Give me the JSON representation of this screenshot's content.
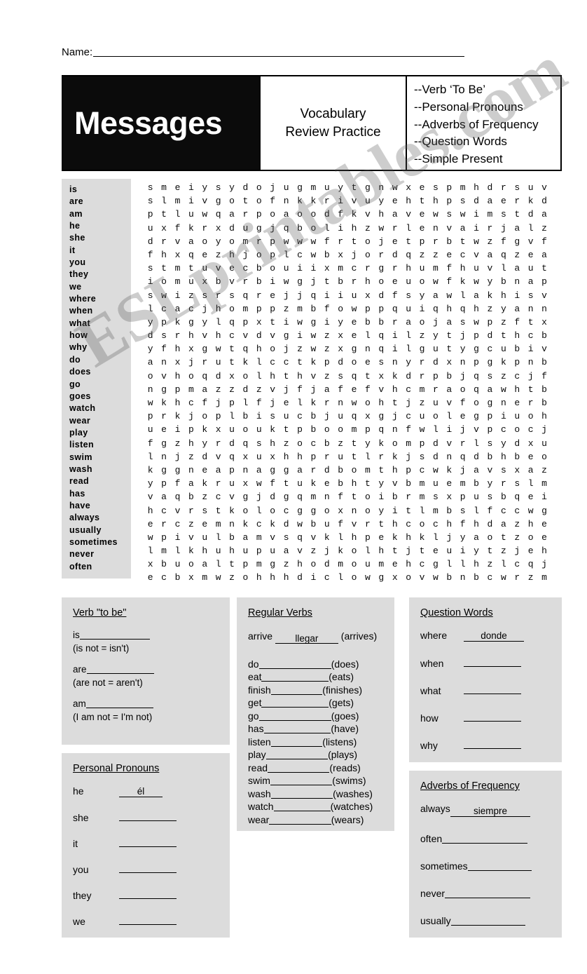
{
  "name_field": {
    "label": "Name:",
    "value": ""
  },
  "header": {
    "title": "Messages",
    "subtitle_line1": "Vocabulary",
    "subtitle_line2": "Review Practice",
    "topics": [
      "--Verb ‘To Be’",
      "--Personal Pronouns",
      "--Adverbs of Frequency",
      "--Question Words",
      "--Simple Present"
    ]
  },
  "word_bank": [
    "is",
    "are",
    "am",
    "he",
    "she",
    "it",
    "you",
    "they",
    "we",
    "where",
    "when",
    "what",
    "how",
    "why",
    "do",
    "does",
    "go",
    "goes",
    "watch",
    "wear",
    "play",
    "listen",
    "swim",
    "wash",
    "read",
    "has",
    "have",
    "always",
    "usually",
    "sometimes",
    "never",
    "often"
  ],
  "word_search": {
    "columns": 31,
    "rows": 30,
    "rows_text": [
      "smeiysydojugmuytgnwxespmhdrsuv",
      "slmivgotofnkkrivuyehthpsdaerkd",
      "ptluwqarpoaoodfkvhavewswimstda",
      "uxfkrxdugjqbolihzwrlenvairjalz",
      "drvaoyomrpwwwfrtojetprbtwzfgvf",
      "fhxqezhjoplcwbxjordqzzecvaqzea",
      "stmtuvecbouiixmcrgrhumfhuvlaut",
      "iomuxbvrbiwgjtbrhoeuowfkwybnap",
      "swizsrsqrejjqiiuxdfsyawlakhisv",
      "lcacjhomppzmbfowppquiqhqhzyann",
      "ypkgylqpxtiwgiyebbraojaswpzftx",
      "dsrhvhcvdvgiwzxelqilzytjpdthcb",
      "yfhxgwtqhojzwzxgnqilgutygcubiv",
      "anxjrutklcctkpdoesnyrdxnpgkpnb",
      "ovhoqdxolhthvzsqtxkdrpbjqszcjf",
      "ngpmazzdzvjfjafefvhcmraoqawhtb",
      "wkhcfjplfjelkrnwohtjzuvfognerb",
      "prkjoplbisucbjuqxgjcuolegpiuoh",
      "ueipkxuouktpboompqnfwlijvpcocj",
      "fgzhyrdqshzocbztykompdvrlsydxu",
      "lnjzdvqxuxhhprutlrkjsdnqdbhbeo",
      "kggneapnaggardbomthpcwkjavsxaz",
      "ypfakruxwftukebhtyvbmuembyrslm",
      "vaqbzcvgjdgqmnftoibrmsxpusbqei",
      "hcvrstkolocggoxnoyitlmbslfccwg",
      "erczemnkckdwbufvrthcochfhdazhe",
      "wpivulbamvsqvklhpekhkljyaotzoe",
      "lmlkhuhupuavzjkolhtjteuiytzjeh",
      "xbuoaltpmgzhodmoumehcgllhzlcqj",
      "ecbxmwzohhhdiclowgxovwbnbcwrzm"
    ]
  },
  "watermark": {
    "text": "ESLprintables.com"
  },
  "boxes": {
    "verb_to_be": {
      "title": "Verb  \"to be\"",
      "entries": [
        {
          "word": "is",
          "answer": "",
          "note": "(is not = isn't)"
        },
        {
          "word": "are",
          "answer": "",
          "note": "(are not = aren't)"
        },
        {
          "word": "am",
          "answer": "",
          "note": "(I am not = I'm not)"
        }
      ]
    },
    "personal_pronouns": {
      "title": "Personal Pronouns",
      "entries": [
        {
          "word": "he",
          "answer": "él"
        },
        {
          "word": "she",
          "answer": ""
        },
        {
          "word": "it",
          "answer": ""
        },
        {
          "word": "you",
          "answer": ""
        },
        {
          "word": "they",
          "answer": ""
        },
        {
          "word": "we",
          "answer": ""
        }
      ]
    },
    "regular_verbs": {
      "title": "Regular Verbs",
      "example": {
        "word": "arrive",
        "answer": "llegar",
        "third_person": "(arrives)"
      },
      "entries": [
        {
          "word": "do",
          "answer": "",
          "third_person": "(does)"
        },
        {
          "word": "eat",
          "answer": "",
          "third_person": "(eats)"
        },
        {
          "word": "finish",
          "answer": "",
          "third_person": "(finishes)"
        },
        {
          "word": "get",
          "answer": "",
          "third_person": "(gets)"
        },
        {
          "word": "go",
          "answer": "",
          "third_person": "(goes)"
        },
        {
          "word": "has",
          "answer": "",
          "third_person": "(have)"
        },
        {
          "word": "listen",
          "answer": "",
          "third_person": "(listens)"
        },
        {
          "word": "play",
          "answer": "",
          "third_person": "(plays)"
        },
        {
          "word": "read",
          "answer": "",
          "third_person": "(reads)"
        },
        {
          "word": "swim",
          "answer": "",
          "third_person": "(swims)"
        },
        {
          "word": "wash",
          "answer": "",
          "third_person": "(washes)"
        },
        {
          "word": "watch",
          "answer": "",
          "third_person": "(watches)"
        },
        {
          "word": "wear",
          "answer": "",
          "third_person": "(wears)"
        }
      ]
    },
    "question_words": {
      "title": "Question Words",
      "entries": [
        {
          "word": "where",
          "answer": "donde"
        },
        {
          "word": "when",
          "answer": ""
        },
        {
          "word": "what",
          "answer": ""
        },
        {
          "word": "how",
          "answer": ""
        },
        {
          "word": "why",
          "answer": ""
        }
      ]
    },
    "adverbs_of_frequency": {
      "title": "Adverbs of Frequency",
      "entries": [
        {
          "word": "always",
          "answer": "siempre"
        },
        {
          "word": "often",
          "answer": ""
        },
        {
          "word": "sometimes",
          "answer": ""
        },
        {
          "word": "never",
          "answer": ""
        },
        {
          "word": "usually",
          "answer": ""
        }
      ]
    }
  },
  "colors": {
    "banner_black": "#0b0b0b",
    "panel_gray": "#dcdcdc",
    "page_white": "#ffffff"
  }
}
